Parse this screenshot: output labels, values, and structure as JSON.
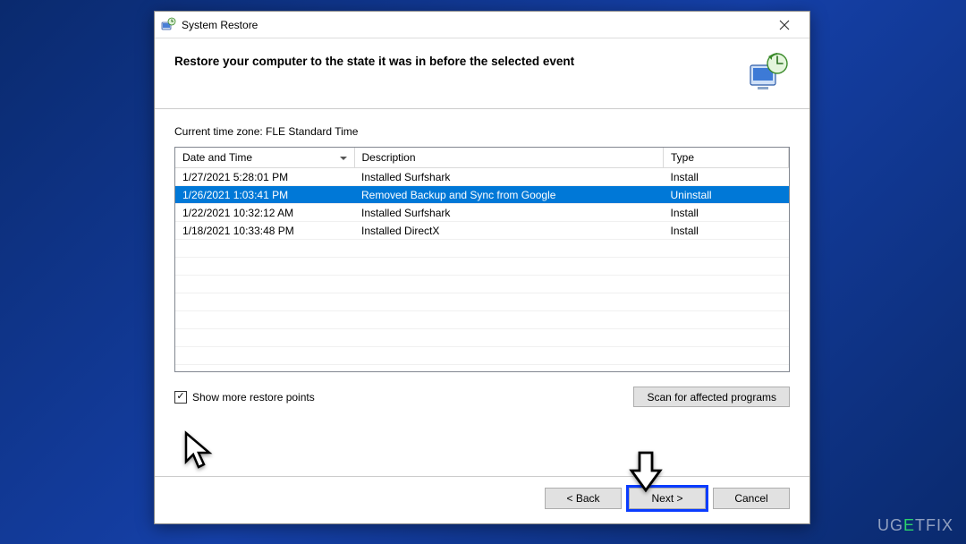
{
  "window": {
    "title": "System Restore",
    "heading": "Restore your computer to the state it was in before the selected event"
  },
  "timezone_label": "Current time zone: FLE Standard Time",
  "table": {
    "headers": {
      "date": "Date and Time",
      "desc": "Description",
      "type": "Type"
    },
    "rows": [
      {
        "date": "1/27/2021 5:28:01 PM",
        "desc": "Installed Surfshark",
        "type": "Install",
        "selected": false
      },
      {
        "date": "1/26/2021 1:03:41 PM",
        "desc": "Removed Backup and Sync from Google",
        "type": "Uninstall",
        "selected": true
      },
      {
        "date": "1/22/2021 10:32:12 AM",
        "desc": "Installed Surfshark",
        "type": "Install",
        "selected": false
      },
      {
        "date": "1/18/2021 10:33:48 PM",
        "desc": "Installed DirectX",
        "type": "Install",
        "selected": false
      }
    ]
  },
  "checkbox": {
    "label": "Show more restore points",
    "checked": true
  },
  "scan_button": "Scan for affected programs",
  "buttons": {
    "back": "< Back",
    "next": "Next >",
    "cancel": "Cancel"
  },
  "watermark": {
    "pre": "UG",
    "e": "E",
    "post": "TFIX"
  }
}
